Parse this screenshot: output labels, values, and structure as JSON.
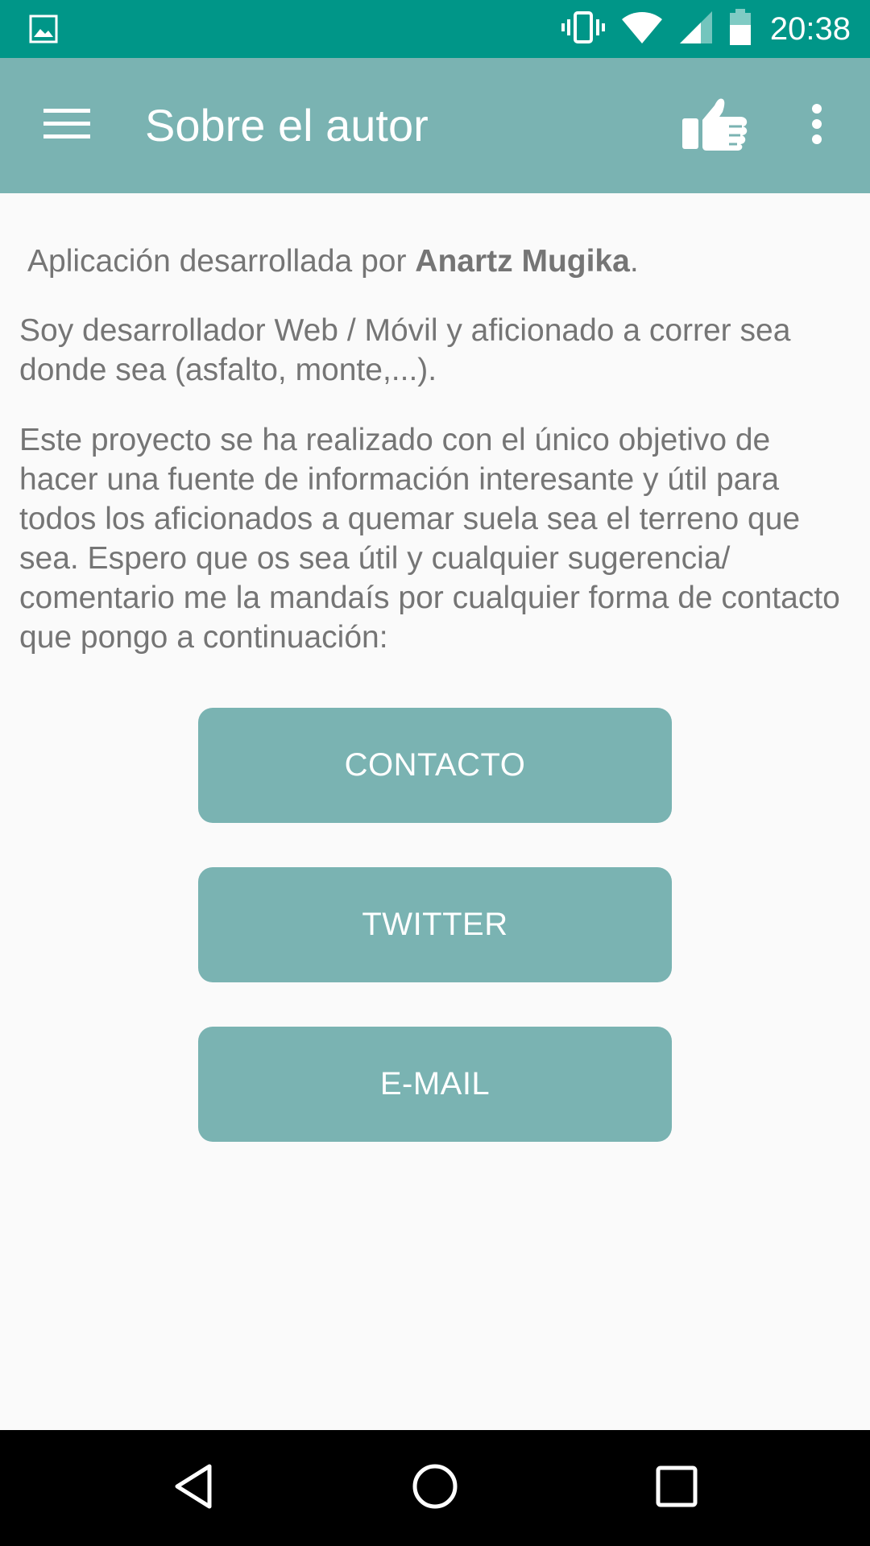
{
  "status_bar": {
    "time": "20:38"
  },
  "app_bar": {
    "title": "Sobre el autor"
  },
  "content": {
    "intro_prefix": "Aplicación desarrollada por ",
    "author_name": "Anartz Mugika",
    "intro_suffix": ".",
    "paragraph_2": "Soy desarrollador Web / Móvil y aficionado a correr sea donde sea (asfalto, monte,...).",
    "paragraph_3": "Este proyecto se ha realizado con el único objetivo de hacer una fuente de información interesante y útil para todos los aficionados a quemar suela sea el terreno que sea. Espero que os sea útil y cualquier sugerencia/ comentario me la mandaís por cualquier forma de contacto que pongo a continuación:"
  },
  "buttons": {
    "contact_label": "CONTACTO",
    "twitter_label": "TWITTER",
    "email_label": "E-MAIL"
  },
  "icons": {
    "status_left": "image-notification-icon",
    "vibrate": "vibrate-icon",
    "wifi": "wifi-icon",
    "signal": "cell-signal-icon",
    "battery": "battery-icon",
    "menu": "hamburger-menu-icon",
    "like": "thumbs-up-icon",
    "more": "more-vert-icon",
    "nav_back": "back-triangle-icon",
    "nav_home": "home-circle-icon",
    "nav_recents": "recents-square-icon"
  },
  "colors": {
    "status_bar": "#009688",
    "app_bar": "#7ab3b2",
    "button": "#7ab3b2",
    "background": "#fafafa",
    "body_text": "#757575",
    "nav_bar": "#000000"
  }
}
